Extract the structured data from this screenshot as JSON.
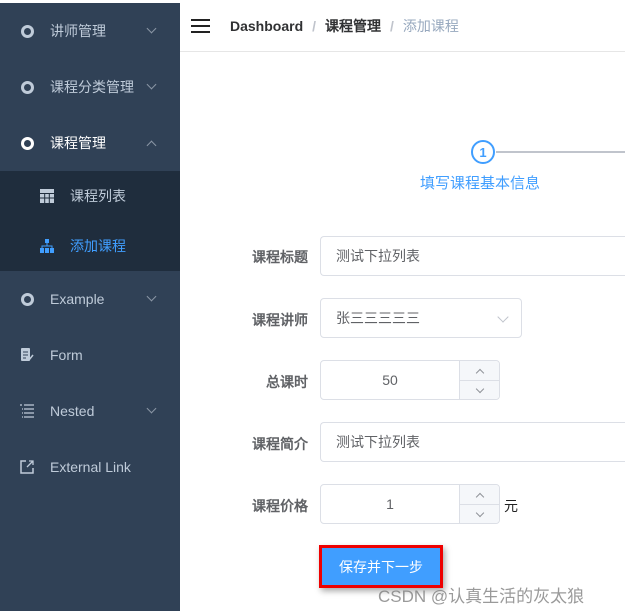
{
  "sidebar": {
    "items": [
      {
        "label": "讲师管理",
        "icon": "ring-icon",
        "expandable": true
      },
      {
        "label": "课程分类管理",
        "icon": "ring-icon",
        "expandable": true
      },
      {
        "label": "课程管理",
        "icon": "ring-icon",
        "expandable": true,
        "expanded": true,
        "children": [
          {
            "label": "课程列表",
            "icon": "table-icon"
          },
          {
            "label": "添加课程",
            "icon": "tree-icon",
            "active": true
          }
        ]
      },
      {
        "label": "Example",
        "icon": "ring-icon",
        "expandable": true
      },
      {
        "label": "Form",
        "icon": "form-icon"
      },
      {
        "label": "Nested",
        "icon": "list-icon",
        "expandable": true
      },
      {
        "label": "External Link",
        "icon": "external-link-icon"
      }
    ]
  },
  "header": {
    "breadcrumb": [
      "Dashboard",
      "课程管理",
      "添加课程"
    ],
    "separator": "/"
  },
  "steps": {
    "current": "1",
    "title": "填写课程基本信息"
  },
  "form": {
    "title": {
      "label": "课程标题",
      "value": "测试下拉列表"
    },
    "teacher": {
      "label": "课程讲师",
      "value": "张三三三三三"
    },
    "hours": {
      "label": "总课时",
      "value": "50"
    },
    "intro": {
      "label": "课程简介",
      "value": "测试下拉列表"
    },
    "price": {
      "label": "课程价格",
      "value": "1",
      "unit": "元"
    },
    "submit": "保存并下一步"
  },
  "watermark": "CSDN @认真生活的灰太狼",
  "colors": {
    "sidebar": "#304156",
    "submenu": "#1f2d3d",
    "accent": "#409eff"
  }
}
